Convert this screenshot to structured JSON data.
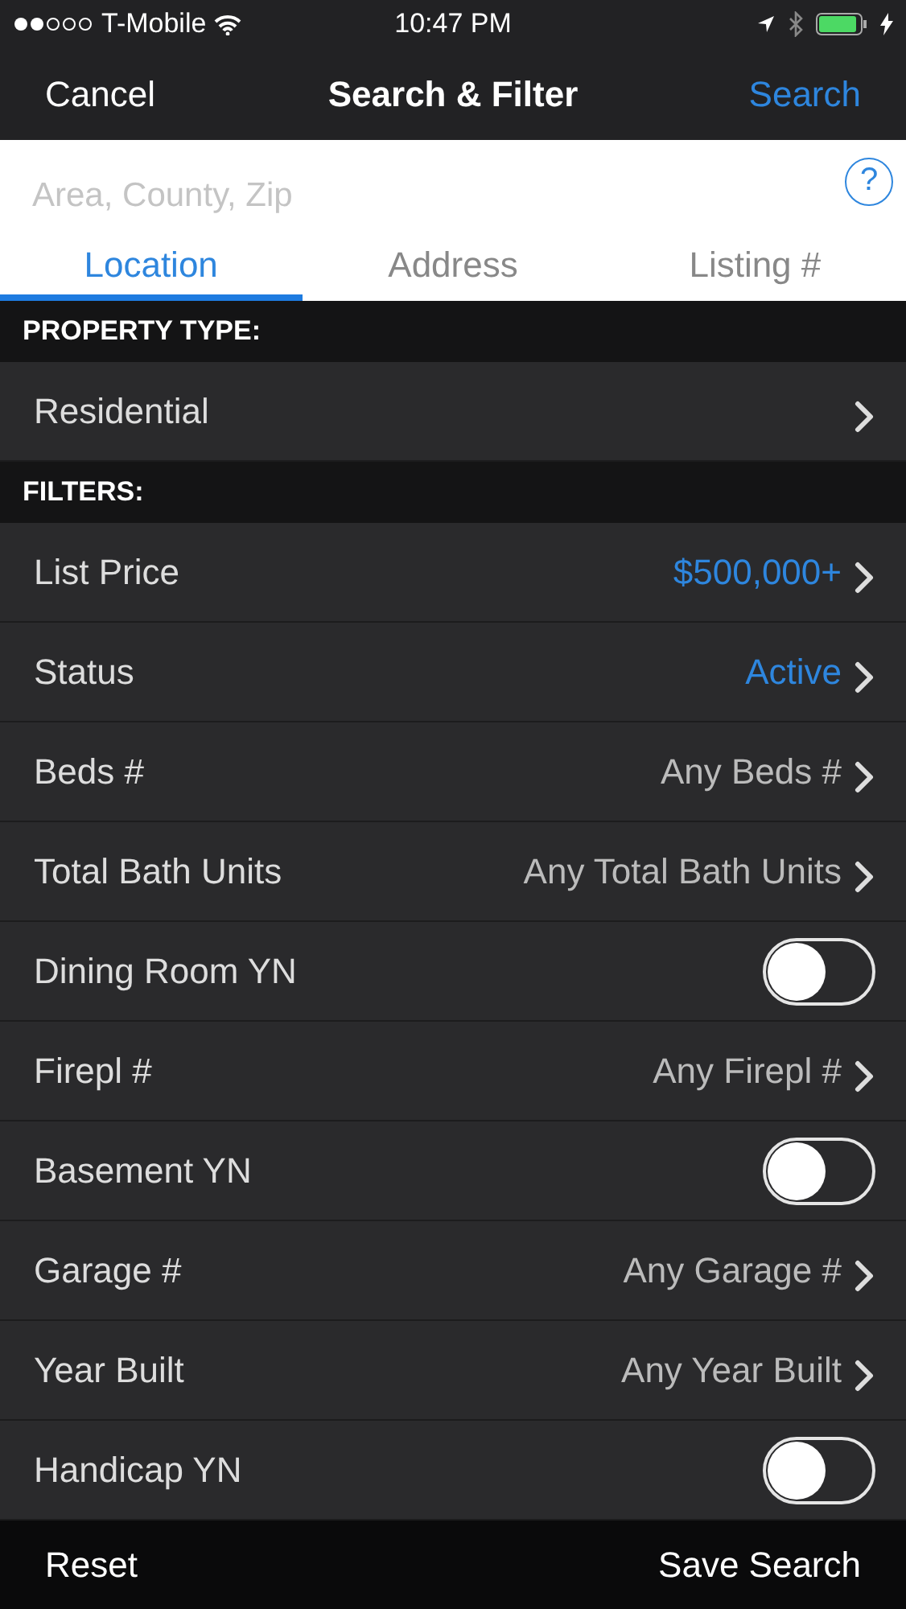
{
  "status_bar": {
    "carrier": "T-Mobile",
    "time": "10:47 PM"
  },
  "nav": {
    "cancel": "Cancel",
    "title": "Search & Filter",
    "search": "Search"
  },
  "search": {
    "placeholder": "Area, County, Zip",
    "help": "?"
  },
  "tabs": [
    {
      "label": "Location",
      "selected": true
    },
    {
      "label": "Address",
      "selected": false
    },
    {
      "label": "Listing #",
      "selected": false
    }
  ],
  "sections": [
    {
      "title": "PROPERTY TYPE:",
      "rows": [
        {
          "kind": "select",
          "label": "Residential"
        }
      ]
    },
    {
      "title": "FILTERS:",
      "rows": [
        {
          "kind": "select",
          "label": "List Price",
          "value": "$500,000+",
          "set": true
        },
        {
          "kind": "select",
          "label": "Status",
          "value": "Active",
          "set": true
        },
        {
          "kind": "select",
          "label": "Beds #",
          "value": "Any Beds #",
          "set": false
        },
        {
          "kind": "select",
          "label": "Total Bath Units",
          "value": "Any Total Bath Units",
          "set": false
        },
        {
          "kind": "toggle",
          "label": "Dining Room YN",
          "on": false
        },
        {
          "kind": "select",
          "label": "Firepl #",
          "value": "Any Firepl #",
          "set": false
        },
        {
          "kind": "toggle",
          "label": "Basement YN",
          "on": false
        },
        {
          "kind": "select",
          "label": "Garage #",
          "value": "Any Garage #",
          "set": false
        },
        {
          "kind": "select",
          "label": "Year Built",
          "value": "Any Year Built",
          "set": false
        },
        {
          "kind": "toggle",
          "label": "Handicap YN",
          "on": false
        }
      ]
    }
  ],
  "toolbar": {
    "reset": "Reset",
    "save": "Save Search"
  }
}
